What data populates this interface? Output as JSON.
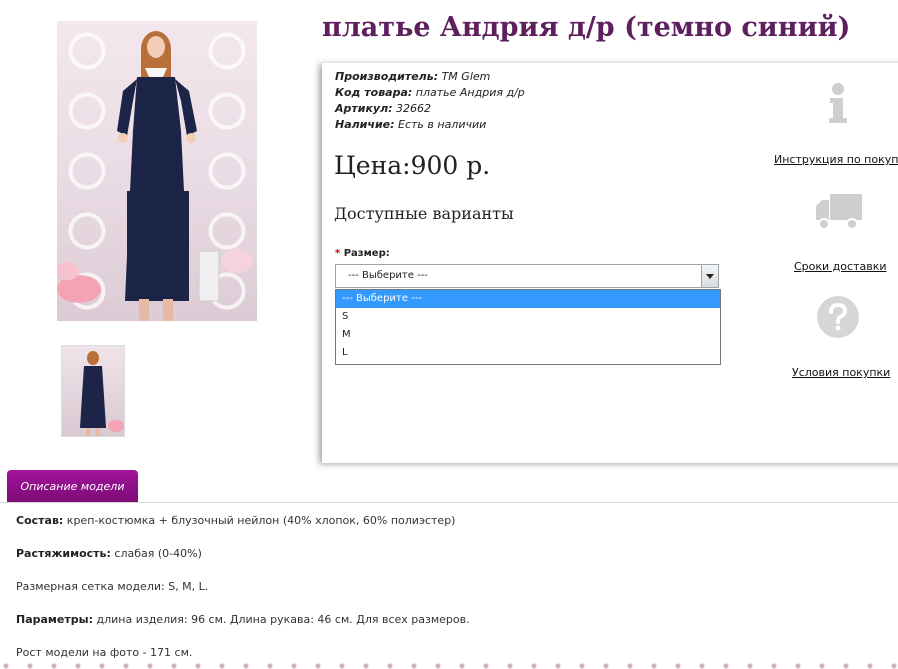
{
  "product": {
    "title": "платье Андрия д/р (темно синий)",
    "meta": [
      {
        "label": "Производитель:",
        "value": " TM Glem"
      },
      {
        "label": "Код товара:",
        "value": " платье Андрия д/р"
      },
      {
        "label": "Артикул:",
        "value": " 32662"
      },
      {
        "label": "Наличие:",
        "value": " Есть в наличии"
      }
    ],
    "price": "Цена:900 р.",
    "variants_heading": "Доступные варианты",
    "size_label": "Размер:",
    "size_required_mark": "*",
    "size_selected": "--- Выберите ---",
    "size_options": [
      "--- Выберите ---",
      "S",
      "M",
      "L"
    ]
  },
  "side_links": {
    "instructions": "Инструкция по покупке",
    "delivery": "Сроки доставки",
    "terms": "Условия покупки"
  },
  "icons": {
    "info": "info-icon",
    "truck": "truck-icon",
    "question": "question-icon"
  },
  "tabs": {
    "description": "Описание модели"
  },
  "description": [
    {
      "label": "Состав:",
      "value": " креп-костюмка + блузочный нейлон (40% хлопок, 60% полиэстер)"
    },
    {
      "label": "Растяжимость:",
      "value": " слабая (0-40%)"
    },
    {
      "label": "",
      "value": "Размерная сетка модели: S, M, L."
    },
    {
      "label": "Параметры:",
      "value": " длина изделия: 96 см. Длина рукава: 46 см. Для всех размеров."
    },
    {
      "label": "",
      "value": "Рост модели на фото - 171 см."
    }
  ],
  "colors": {
    "accent": "#5e1f5f",
    "tab": "#8d0f86",
    "selection": "#3399ff",
    "dress": "#1c2447"
  }
}
